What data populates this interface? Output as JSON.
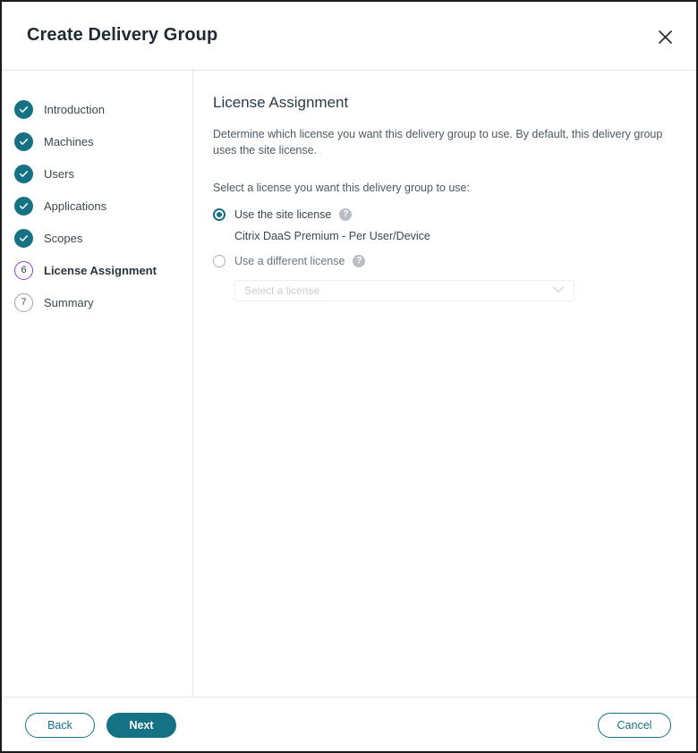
{
  "window": {
    "title": "Create Delivery Group",
    "close_icon": "close-icon"
  },
  "sidebar": {
    "steps": [
      {
        "label": "Introduction",
        "state": "done",
        "marker": "check-icon"
      },
      {
        "label": "Machines",
        "state": "done",
        "marker": "check-icon"
      },
      {
        "label": "Users",
        "state": "done",
        "marker": "check-icon"
      },
      {
        "label": "Applications",
        "state": "done",
        "marker": "check-icon"
      },
      {
        "label": "Scopes",
        "state": "done",
        "marker": "check-icon"
      },
      {
        "label": "License Assignment",
        "state": "current",
        "marker": "6"
      },
      {
        "label": "Summary",
        "state": "pending",
        "marker": "7"
      }
    ]
  },
  "main": {
    "title": "License Assignment",
    "description": "Determine which license you want this delivery group to use. By default, this delivery group uses the site license.",
    "select_prompt": "Select a license you want this delivery group to use:",
    "options": {
      "site_license": {
        "label": "Use the site license",
        "help_icon": "help-icon",
        "selected": true,
        "license_name": "Citrix DaaS Premium - Per User/Device"
      },
      "different_license": {
        "label": "Use a different license",
        "help_icon": "help-icon",
        "selected": false
      }
    },
    "license_select": {
      "placeholder": "Select a license",
      "value": "",
      "chevron_icon": "chevron-down-icon",
      "disabled": true
    }
  },
  "footer": {
    "back_label": "Back",
    "next_label": "Next",
    "cancel_label": "Cancel"
  },
  "colors": {
    "accent": "#157284",
    "current_step": "#8b3fd6",
    "text": "#3b4750",
    "border": "#e2e4e6"
  }
}
